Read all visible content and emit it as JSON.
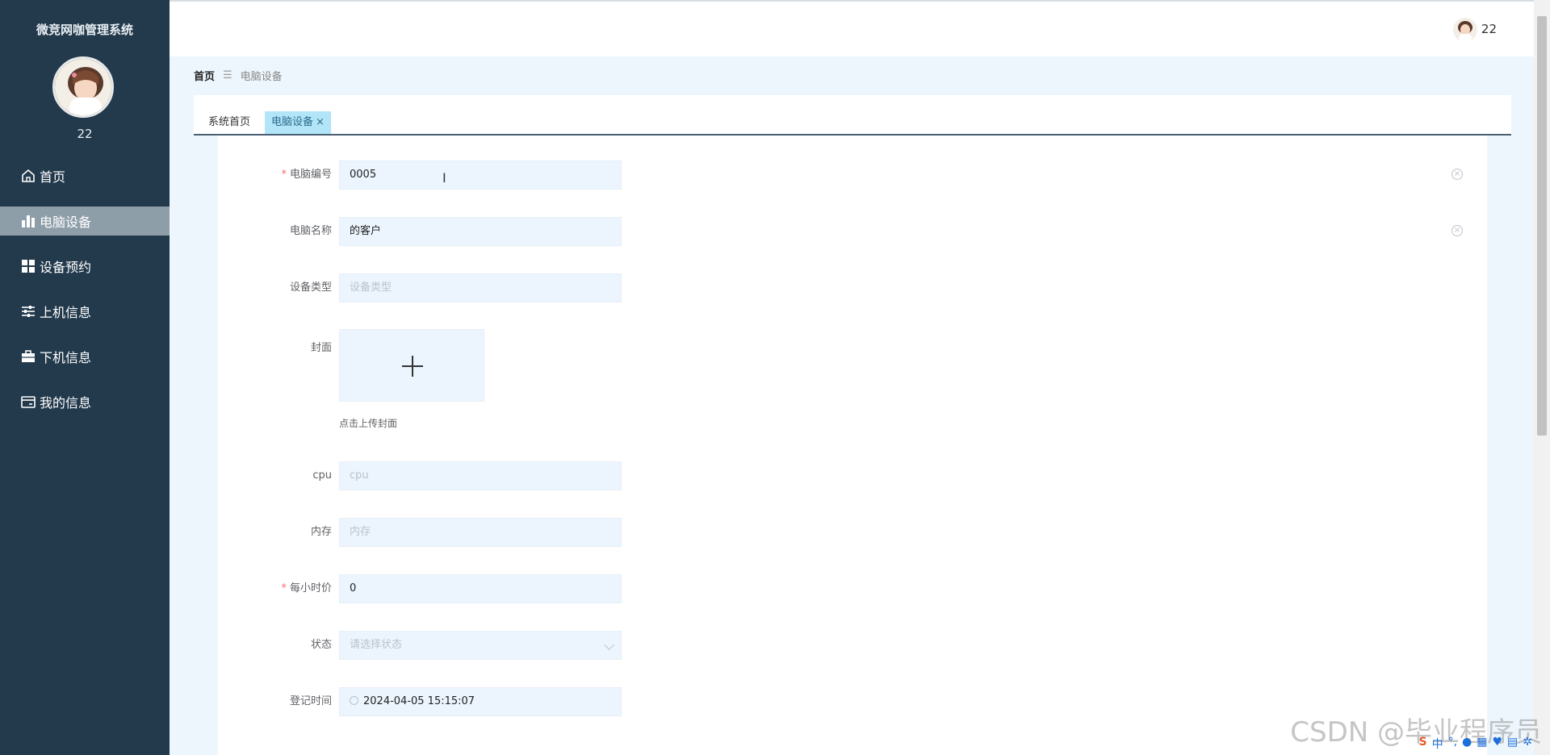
{
  "sidebar": {
    "system_title": "微竞网咖管理系统",
    "username": "22",
    "items": [
      {
        "label": "首页",
        "icon": "home-icon"
      },
      {
        "label": "电脑设备",
        "icon": "bar-chart-icon",
        "active": true
      },
      {
        "label": "设备预约",
        "icon": "grid-icon"
      },
      {
        "label": "上机信息",
        "icon": "sliders-icon"
      },
      {
        "label": "下机信息",
        "icon": "briefcase-icon"
      },
      {
        "label": "我的信息",
        "icon": "card-icon"
      }
    ]
  },
  "topbar": {
    "username": "22"
  },
  "breadcrumb": {
    "home": "首页",
    "separator": "☰",
    "current": "电脑设备"
  },
  "tabs": [
    {
      "label": "系统首页"
    },
    {
      "label": "电脑设备",
      "close": "×"
    }
  ],
  "form": {
    "computer_no": {
      "label": "电脑编号",
      "value": "0005",
      "required": true
    },
    "computer_name": {
      "label": "电脑名称",
      "value": "的客户"
    },
    "device_type": {
      "label": "设备类型",
      "placeholder": "设备类型"
    },
    "cover": {
      "label": "封面",
      "hint": "点击上传封面"
    },
    "cpu": {
      "label": "cpu",
      "placeholder": "cpu"
    },
    "memory": {
      "label": "内存",
      "placeholder": "内存"
    },
    "hourly_price": {
      "label": "每小时价",
      "value": "0",
      "required": true
    },
    "status": {
      "label": "状态",
      "placeholder": "请选择状态"
    },
    "register_time": {
      "label": "登记时间",
      "value": "2024-04-05 15:15:07"
    }
  },
  "watermark": "CSDN @毕业程序员",
  "ime": {
    "mode": "中"
  },
  "colors": {
    "sidebar_bg": "#233a4d",
    "active_menu_bg": "#8e9ea9",
    "input_bg": "#ecf5fe",
    "active_tab_bg": "#b3e5f8",
    "required": "#f56c6c"
  }
}
